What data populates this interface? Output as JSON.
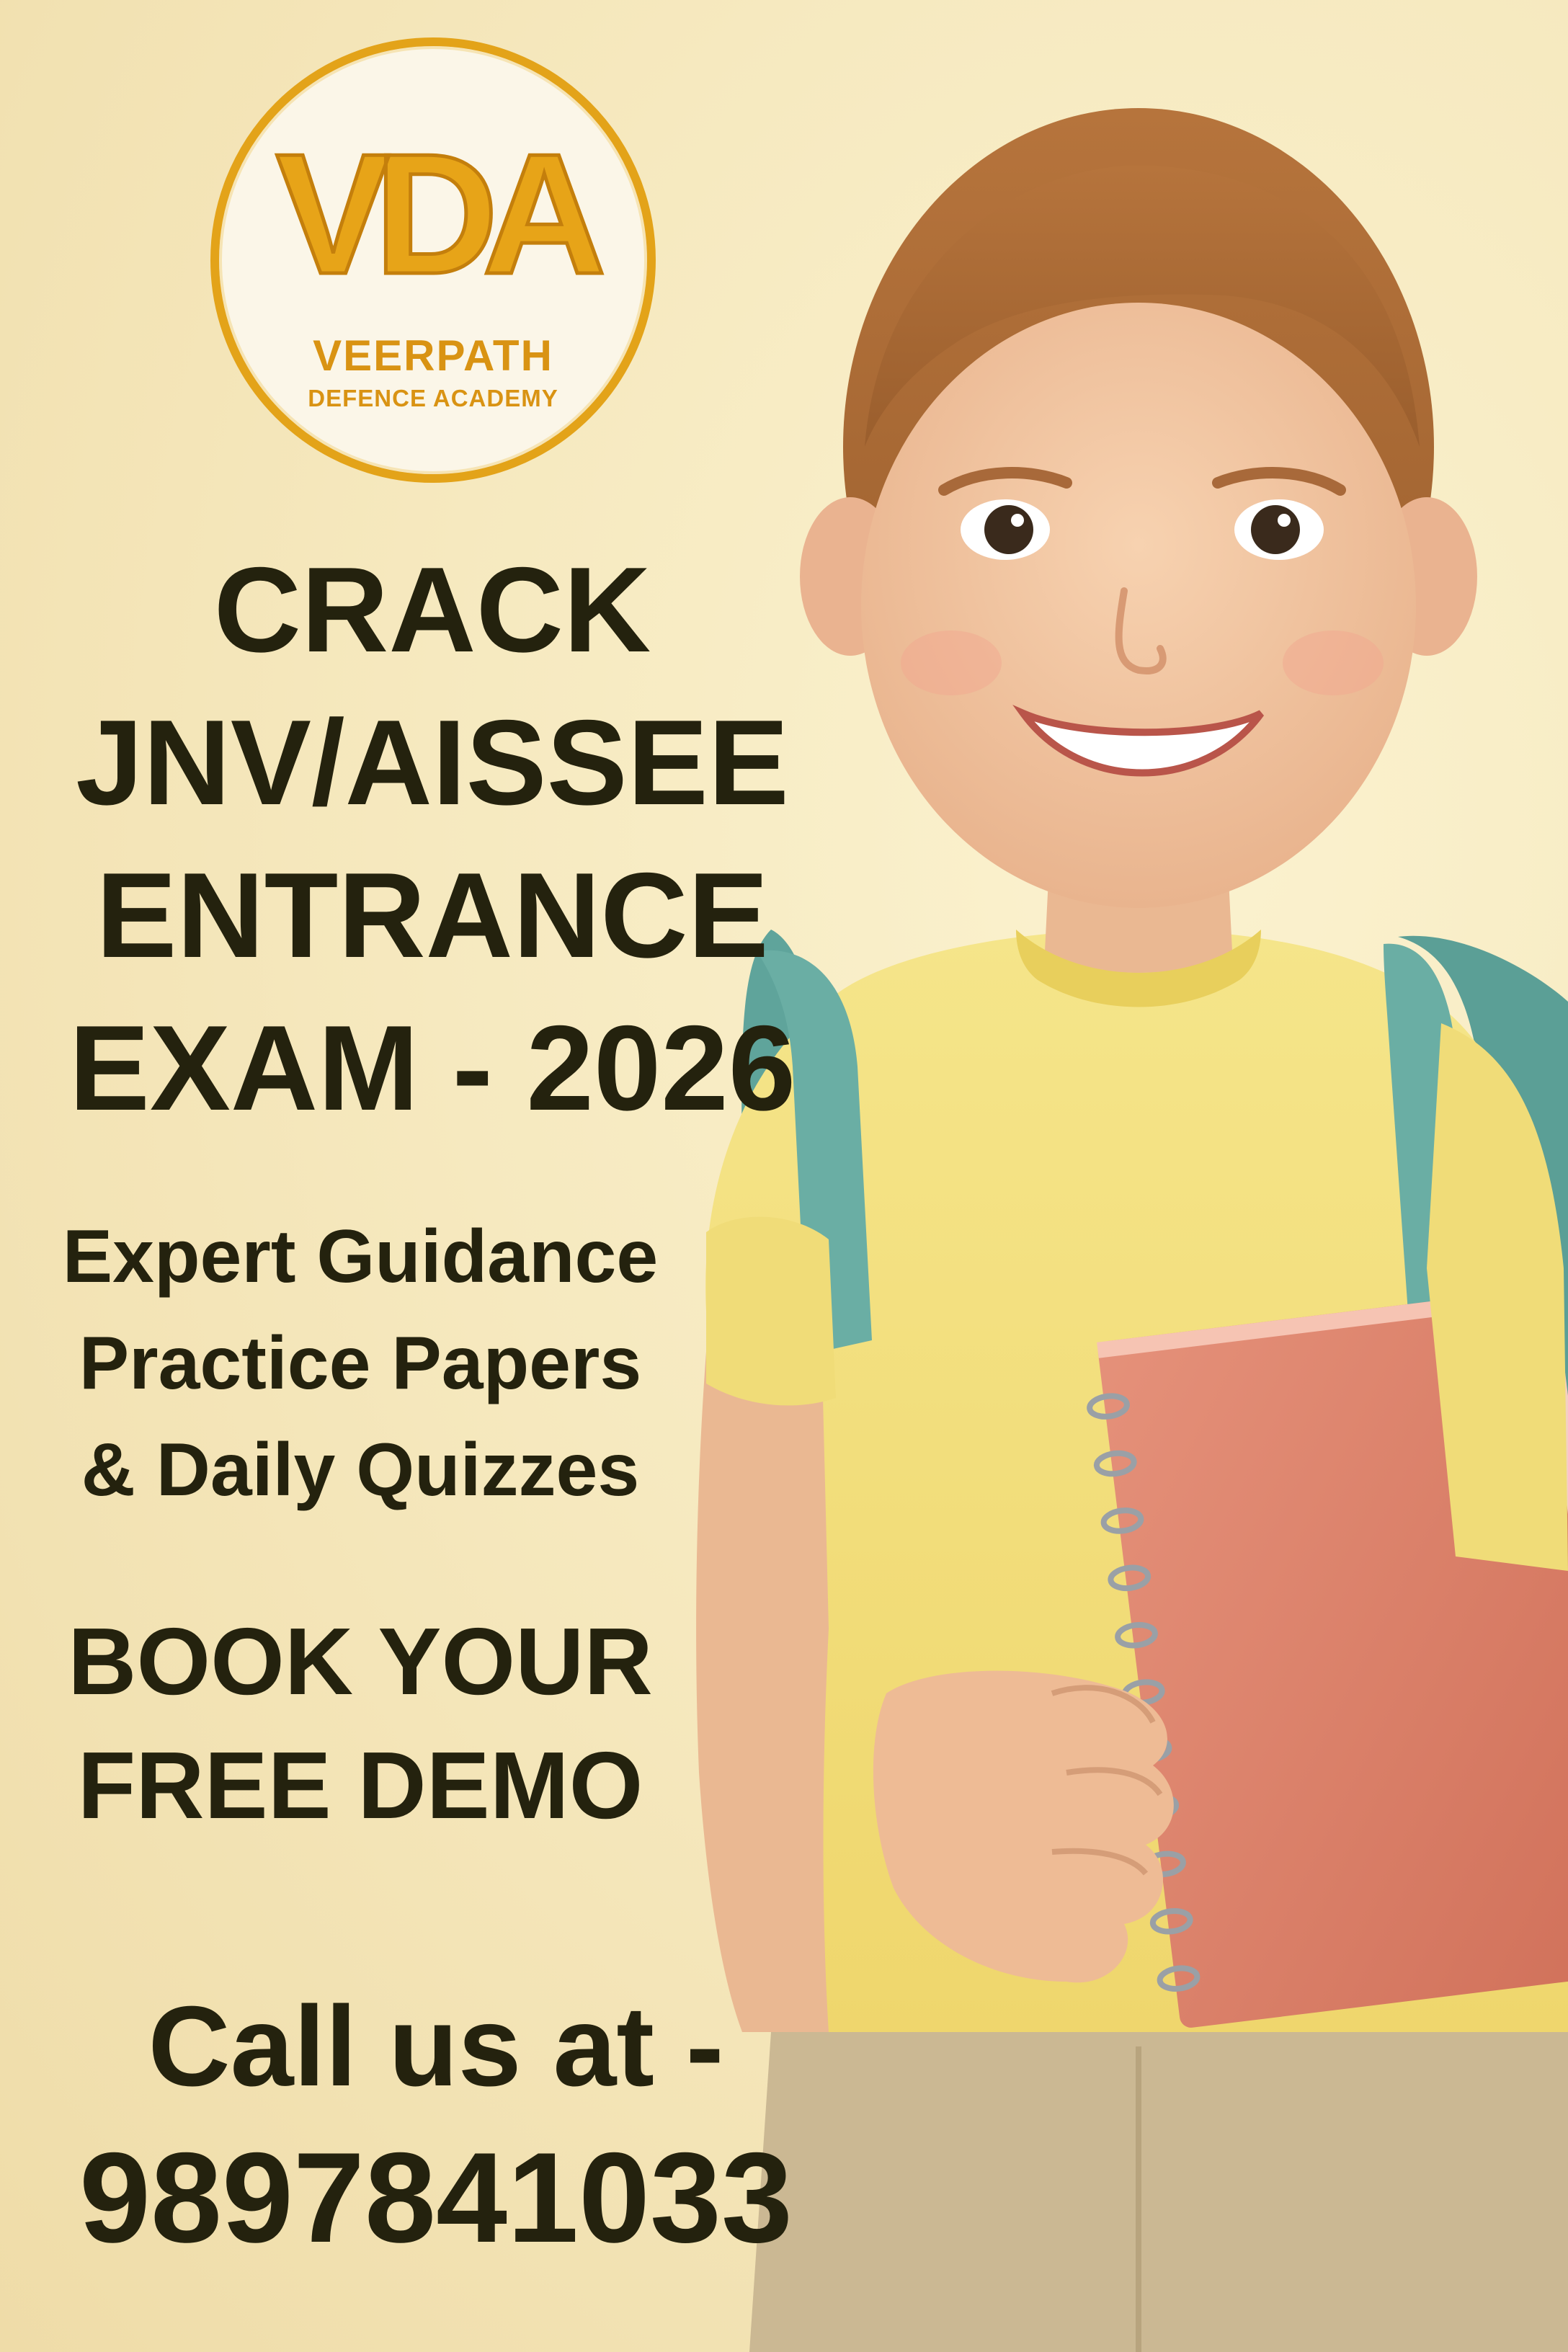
{
  "logo": {
    "mark": "VDA",
    "name": "VEERPATH",
    "subtitle": "DEFENCE ACADEMY"
  },
  "headline": {
    "lines": [
      "CRACK",
      "JNV/AISSEE",
      "ENTRANCE",
      "EXAM - 2026"
    ]
  },
  "features": {
    "lines": [
      "Expert Guidance",
      "Practice Papers",
      "& Daily Quizzes"
    ]
  },
  "cta": {
    "lines": [
      "BOOK YOUR",
      "FREE DEMO"
    ]
  },
  "contact": {
    "label": "Call us at -",
    "phone": "9897841033"
  },
  "colors": {
    "background": "#f6e9bf",
    "logo_gold": "#e3a319",
    "text_dark": "#24220e",
    "shirt_yellow": "#f3e27a",
    "backpack_teal": "#5fa49b",
    "notebook_coral": "#df826a"
  },
  "image": {
    "subject": "smiling-child-with-backpack-and-notebook"
  }
}
